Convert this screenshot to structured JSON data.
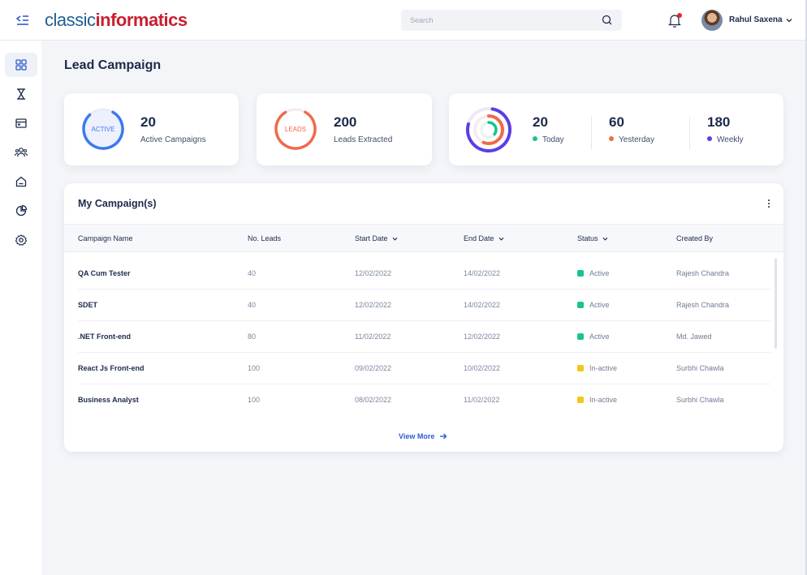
{
  "header": {
    "logo_part1": "classic",
    "logo_part2": "informatics",
    "search_placeholder": "Search",
    "user_name": "Rahul Saxena"
  },
  "sidebar": {
    "items": [
      {
        "icon": "dashboard-grid-icon",
        "active": true
      },
      {
        "icon": "hourglass-icon",
        "active": false
      },
      {
        "icon": "window-icon",
        "active": false
      },
      {
        "icon": "users-icon",
        "active": false
      },
      {
        "icon": "home-icon",
        "active": false
      },
      {
        "icon": "pie-chart-icon",
        "active": false
      },
      {
        "icon": "settings-icon",
        "active": false
      }
    ]
  },
  "page": {
    "title": "Lead Campaign"
  },
  "stats": {
    "active": {
      "ring_label": "ACTIVE",
      "value": "20",
      "label": "Active Campaigns",
      "color": "#3a7af0"
    },
    "leads": {
      "ring_label": "LEADS",
      "value": "200",
      "label": "Leads Extracted",
      "color": "#f06a4a"
    },
    "periods": [
      {
        "value": "20",
        "label": "Today",
        "color": "#19c38f"
      },
      {
        "value": "60",
        "label": "Yesterday",
        "color": "#f06a4a"
      },
      {
        "value": "180",
        "label": "Weekly",
        "color": "#5b3ee8"
      }
    ]
  },
  "campaigns": {
    "title": "My Campaign(s)",
    "columns": {
      "name": "Campaign Name",
      "leads": "No. Leads",
      "start": "Start Date",
      "end": "End Date",
      "status": "Status",
      "created_by": "Created By"
    },
    "rows": [
      {
        "name": "QA Cum Tester",
        "leads": "40",
        "start": "12/02/2022",
        "end": "14/02/2022",
        "status": "Active",
        "status_color": "#19c38f",
        "created_by": "Rajesh Chandra"
      },
      {
        "name": "SDET",
        "leads": "40",
        "start": "12/02/2022",
        "end": "14/02/2022",
        "status": "Active",
        "status_color": "#19c38f",
        "created_by": "Rajesh Chandra"
      },
      {
        "name": ".NET Front-end",
        "leads": "80",
        "start": "11/02/2022",
        "end": "12/02/2022",
        "status": "Active",
        "status_color": "#19c38f",
        "created_by": "Md. Jawed"
      },
      {
        "name": "React Js Front-end",
        "leads": "100",
        "start": "09/02/2022",
        "end": "10/02/2022",
        "status": "In-active",
        "status_color": "#f5c518",
        "created_by": "Surbhi Chawla"
      },
      {
        "name": "Business Analyst",
        "leads": "100",
        "start": "08/02/2022",
        "end": "11/02/2022",
        "status": "In-active",
        "status_color": "#f5c518",
        "created_by": "Surbhi Chawla"
      }
    ],
    "view_more": "View More"
  }
}
